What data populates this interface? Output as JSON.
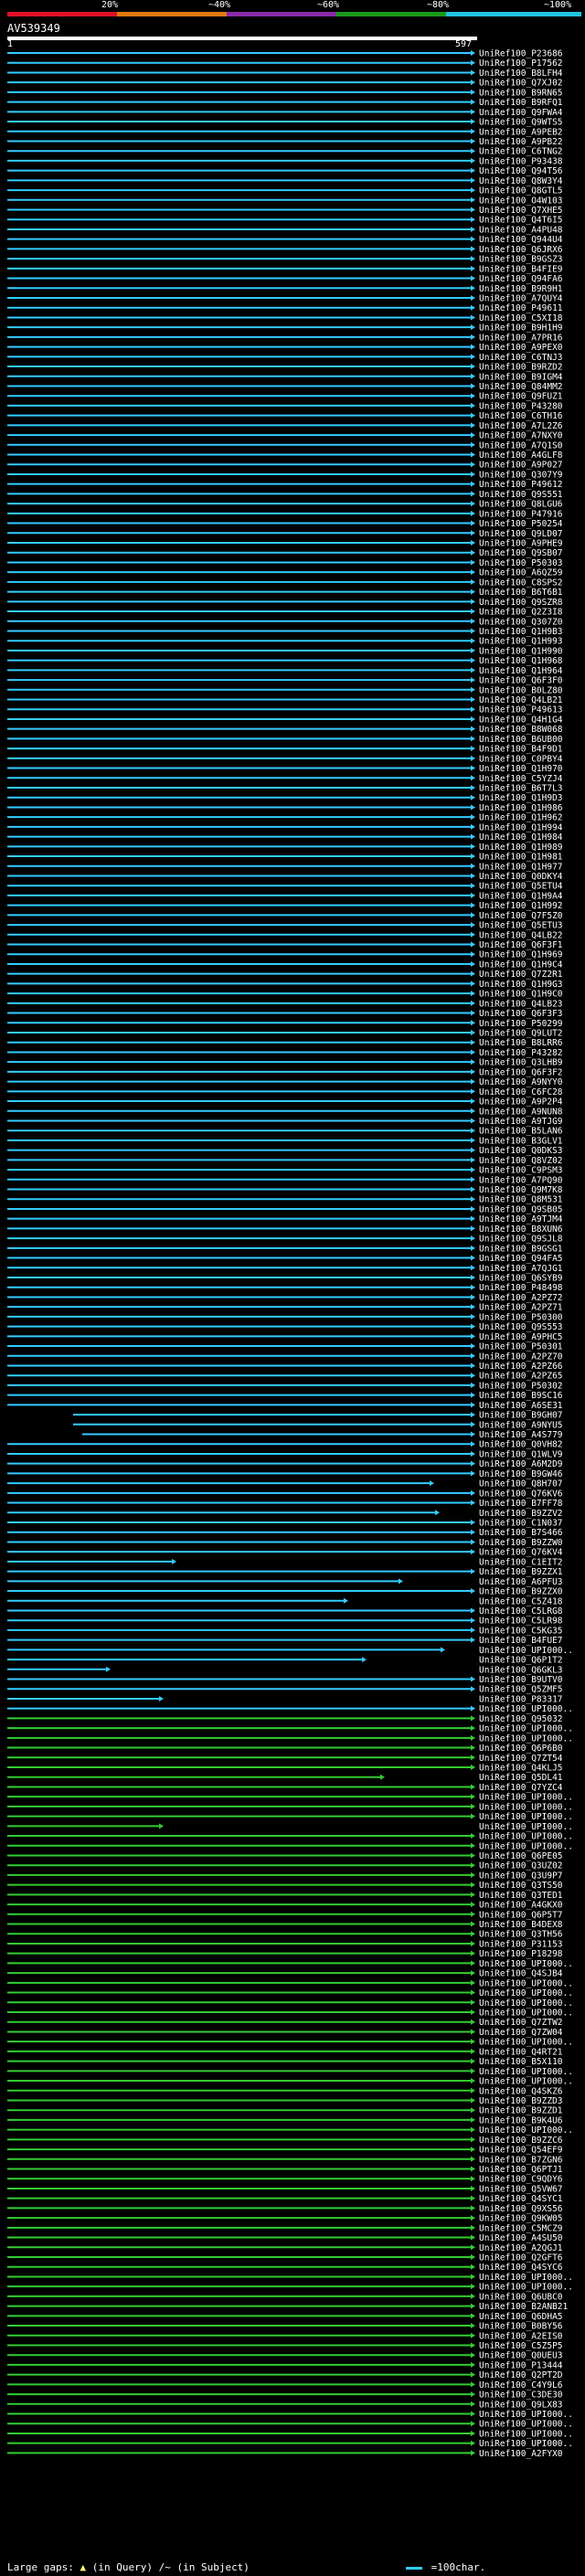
{
  "scale": {
    "labels": [
      "20%",
      "~40%",
      "~60%",
      "~80%",
      "~100%"
    ],
    "band_colors": [
      "#e0102a",
      "#e07a10",
      "#8a2aa8",
      "#1a9a1a",
      "#22c4e0"
    ]
  },
  "query": {
    "name": "AV539349",
    "start": "1",
    "end": "597"
  },
  "colors": {
    "cyan": "#33ccff",
    "green": "#33cc33",
    "dark": "#0c2030"
  },
  "hits": [
    "UniRef100_P23686",
    "UniRef100_P17562",
    "UniRef100_B8LFH4",
    "UniRef100_Q7XJ02",
    "UniRef100_B9RN65",
    "UniRef100_B9RFQ1",
    "UniRef100_Q9FWA4",
    "UniRef100_Q9WTS5",
    "UniRef100_A9PEB2",
    "UniRef100_A9PB22",
    "UniRef100_C6TNG2",
    "UniRef100_P93438",
    "UniRef100_Q94T56",
    "UniRef100_Q8W3Y4",
    "UniRef100_Q8GTL5",
    "UniRef100_O4W103",
    "UniRef100_Q7XHE5",
    "UniRef100_Q4T6I5",
    "UniRef100_A4PU48",
    "UniRef100_Q944U4",
    "UniRef100_Q6JRX6",
    "UniRef100_B9GSZ3",
    "UniRef100_B4FIE9",
    "UniRef100_Q94FA6",
    "UniRef100_B9R9H1",
    "UniRef100_A7QUY4",
    "UniRef100_P49611",
    "UniRef100_C5XI18",
    "UniRef100_B9H1H9",
    "UniRef100_A7PR16",
    "UniRef100_A9PEX0",
    "UniRef100_C6TNJ3",
    "UniRef100_B9RZD2",
    "UniRef100_B9IGM4",
    "UniRef100_Q84MM2",
    "UniRef100_Q9FUZ1",
    "UniRef100_P43280",
    "UniRef100_C6TH16",
    "UniRef100_A7L2Z6",
    "UniRef100_A7NXY0",
    "UniRef100_A7Q1S0",
    "UniRef100_A4GLF8",
    "UniRef100_A9P027",
    "UniRef100_Q307Y9",
    "UniRef100_P49612",
    "UniRef100_Q9S551",
    "UniRef100_Q8LGU6",
    "UniRef100_P47916",
    "UniRef100_P50254",
    "UniRef100_Q9LD07",
    "UniRef100_A9PHE9",
    "UniRef100_Q9SB07",
    "UniRef100_P50303",
    "UniRef100_A6QZ59",
    "UniRef100_C8SPS2",
    "UniRef100_B6T6B1",
    "UniRef100_Q9SZR8",
    "UniRef100_Q2Z3I8",
    "UniRef100_Q307Z0",
    "UniRef100_Q1H9B3",
    "UniRef100_Q1H993",
    "UniRef100_Q1H990",
    "UniRef100_Q1H968",
    "UniRef100_Q1H964",
    "UniRef100_Q6F3F0",
    "UniRef100_B0LZ80",
    "UniRef100_Q4LB21",
    "UniRef100_P49613",
    "UniRef100_Q4H1G4",
    "UniRef100_B8W068",
    "UniRef100_B6UB00",
    "UniRef100_B4F9D1",
    "UniRef100_C0PBY4",
    "UniRef100_Q1H970",
    "UniRef100_C5YZJ4",
    "UniRef100_B6T7L3",
    "UniRef100_Q1H9D3",
    "UniRef100_Q1H986",
    "UniRef100_Q1H962",
    "UniRef100_Q1H994",
    "UniRef100_Q1H984",
    "UniRef100_Q1H989",
    "UniRef100_Q1H981",
    "UniRef100_Q1H977",
    "UniRef100_Q0DKY4",
    "UniRef100_Q5ETU4",
    "UniRef100_Q1H9A4",
    "UniRef100_Q1H992",
    "UniRef100_Q7F5Z0",
    "UniRef100_Q5ETU3",
    "UniRef100_Q4LB22",
    "UniRef100_Q6F3F1",
    "UniRef100_Q1H969",
    "UniRef100_Q1H9C4",
    "UniRef100_Q7Z2R1",
    "UniRef100_Q1H9G3",
    "UniRef100_Q1H9C0",
    "UniRef100_Q4LB23",
    "UniRef100_Q6F3F3",
    "UniRef100_P50299",
    "UniRef100_Q9LUT2",
    "UniRef100_B8LRR6",
    "UniRef100_P43282",
    "UniRef100_Q3LHB9",
    "UniRef100_Q6F3F2",
    "UniRef100_A9NYY0",
    "UniRef100_C6FC28",
    "UniRef100_A9P2P4",
    "UniRef100_A9NUN8",
    "UniRef100_A9TJG9",
    "UniRef100_B5LAN6",
    "UniRef100_B3GLV1",
    "UniRef100_Q0DKS3",
    "UniRef100_Q8VZ02",
    "UniRef100_C9PSM3",
    "UniRef100_A7PQ90",
    "UniRef100_Q9M7K8",
    "UniRef100_Q8M531",
    "UniRef100_Q9SB05",
    "UniRef100_A9TJM4",
    "UniRef100_B8XUN6",
    "UniRef100_Q9SJL8",
    "UniRef100_B9GSG1",
    "UniRef100_Q94FA5",
    "UniRef100_A7QJG1",
    "UniRef100_Q6SYB9",
    "UniRef100_P48498",
    "UniRef100_A2PZ72",
    "UniRef100_A2PZ71",
    "UniRef100_P50300",
    "UniRef100_Q9S553",
    "UniRef100_A9PHC5",
    "UniRef100_P50301",
    "UniRef100_A2PZ70",
    "UniRef100_A2PZ66",
    "UniRef100_A2PZ65",
    "UniRef100_P50302",
    "UniRef100_B9SC16",
    "UniRef100_A6SE31",
    "UniRef100_B9GH07",
    "UniRef100_A9NYU5",
    "UniRef100_A4S779",
    "UniRef100_Q0VH82",
    "UniRef100_Q1WLV9",
    "UniRef100_A6M2D9",
    "UniRef100_B9GW46",
    "UniRef100_Q8H707",
    "UniRef100_Q76KV6",
    "UniRef100_B7FF78",
    "UniRef100_B9ZZV2",
    "UniRef100_C1N037",
    "UniRef100_B7S466",
    "UniRef100_B9ZZW0",
    "UniRef100_Q76KV4",
    "UniRef100_C1EIT2",
    "UniRef100_B9ZZX1",
    "UniRef100_A6PFU3",
    "UniRef100_B9ZZX0",
    "UniRef100_C5Z418",
    "UniRef100_C5LRG8",
    "UniRef100_C5LR98",
    "UniRef100_C5KG35",
    "UniRef100_B4FUE7",
    "UniRef100_UPI000..",
    "UniRef100_Q6P1T2",
    "UniRef100_Q6GKL3",
    "UniRef100_B9UTV0",
    "UniRef100_Q5ZMF5",
    "UniRef100_P83317",
    "UniRef100_UPI000..",
    "UniRef100_Q95032",
    "UniRef100_UPI000..",
    "UniRef100_UPI000..",
    "UniRef100_Q6P6B0",
    "UniRef100_Q7ZT54",
    "UniRef100_Q4KLJ5",
    "UniRef100_Q5DL41",
    "UniRef100_Q7YZC4",
    "UniRef100_UPI000..",
    "UniRef100_UPI000..",
    "UniRef100_UPI000..",
    "UniRef100_UPI000..",
    "UniRef100_UPI000..",
    "UniRef100_UPI000..",
    "UniRef100_Q6PE05",
    "UniRef100_Q3UZ02",
    "UniRef100_Q3U9P7",
    "UniRef100_Q3TS50",
    "UniRef100_Q3TED1",
    "UniRef100_A4GKX0",
    "UniRef100_Q6P5T7",
    "UniRef100_B4DEX8",
    "UniRef100_Q3TH56",
    "UniRef100_P31153",
    "UniRef100_P18298",
    "UniRef100_UPI000..",
    "UniRef100_Q4SJB4",
    "UniRef100_UPI000..",
    "UniRef100_UPI000..",
    "UniRef100_UPI000..",
    "UniRef100_UPI000..",
    "UniRef100_Q7ZTW2",
    "UniRef100_Q7ZW04",
    "UniRef100_UPI000..",
    "UniRef100_Q4RT21",
    "UniRef100_B5X110",
    "UniRef100_UPI000..",
    "UniRef100_UPI000..",
    "UniRef100_Q4SKZ6",
    "UniRef100_B9ZZD3",
    "UniRef100_B9ZZD1",
    "UniRef100_B9K4U6",
    "UniRef100_UPI000..",
    "UniRef100_B9ZZC6",
    "UniRef100_Q54EF9",
    "UniRef100_B7ZGN6",
    "UniRef100_Q6PTJ1",
    "UniRef100_C9QDY6",
    "UniRef100_Q5VW67",
    "UniRef100_Q4SYC1",
    "UniRef100_Q9XS56",
    "UniRef100_Q9KW05",
    "UniRef100_C5MCZ9",
    "UniRef100_A4SU50",
    "UniRef100_A2QGJ1",
    "UniRef100_Q2GFT6",
    "UniRef100_Q4SYC6",
    "UniRef100_UPI000..",
    "UniRef100_UPI000..",
    "UniRef100_Q6UBC0",
    "UniRef100_B2ANB21",
    "UniRef100_Q6DHA5",
    "UniRef100_B0BY56",
    "UniRef100_A2EIS0",
    "UniRef100_C5Z5P5",
    "UniRef100_Q0UEU3",
    "UniRef100_P13444",
    "UniRef100_Q2PT2D",
    "UniRef100_C4Y9L6",
    "UniRef100_C3DE30",
    "UniRef100_Q9LX83",
    "UniRef100_UPI000..",
    "UniRef100_UPI000..",
    "UniRef100_UPI000..",
    "UniRef100_UPI000..",
    "UniRef100_A2FYX0"
  ],
  "legend": {
    "large_gaps_label": "Large gaps:",
    "in_query_label": "(in Query)",
    "in_subject_label": "/~ (in Subject)",
    "scale_label": "=100char."
  }
}
